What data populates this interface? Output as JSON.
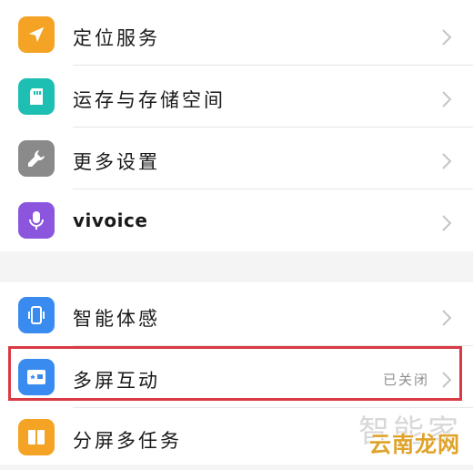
{
  "colors": {
    "accent_red": "#d93a44",
    "icon_orange": "#f5a324",
    "icon_teal": "#1ebfb3",
    "icon_gray": "#8a8a8a",
    "icon_purple": "#8c55dd",
    "icon_blue": "#3a8bf0"
  },
  "settings": {
    "group1": [
      {
        "label": "定位服务",
        "icon": "location-arrow-icon"
      },
      {
        "label": "运存与存储空间",
        "icon": "sd-card-icon"
      },
      {
        "label": "更多设置",
        "icon": "wrench-icon"
      },
      {
        "label": "vivoice",
        "icon": "microphone-icon"
      }
    ],
    "group2": [
      {
        "label": "智能体感",
        "icon": "phone-vibrate-icon"
      },
      {
        "label": "多屏互动",
        "icon": "screen-cast-icon",
        "status": "已关闭"
      },
      {
        "label": "分屏多任务",
        "icon": "split-screen-icon"
      }
    ]
  },
  "watermark": {
    "line1": "智能家",
    "line2": "云南龙网"
  }
}
